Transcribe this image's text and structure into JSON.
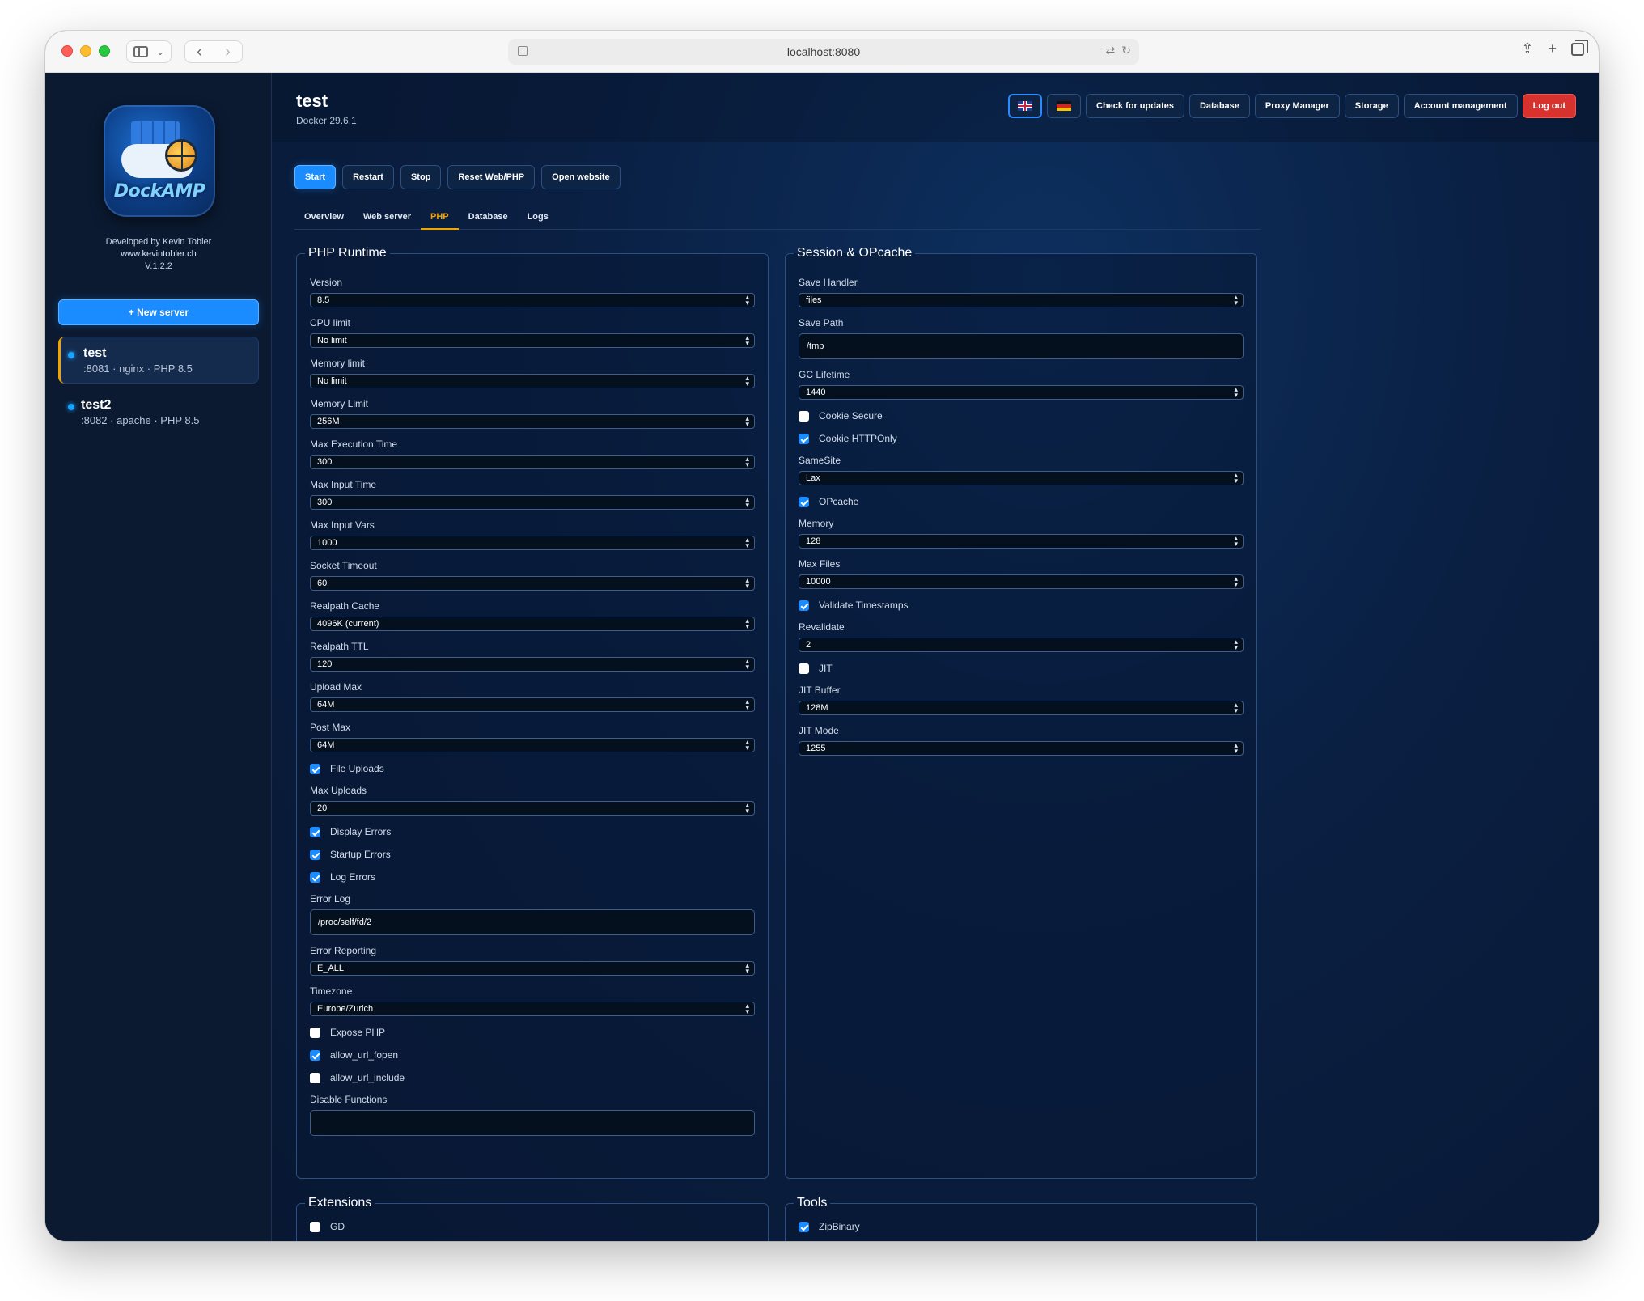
{
  "browser": {
    "url": "localhost:8080"
  },
  "sidebar": {
    "logo_text": "DockAMP",
    "credits": {
      "line1": "Developed by Kevin Tobler",
      "link": "www.kevintobler.ch",
      "version": "V.1.2.2"
    },
    "new_server_label": "+ New server",
    "servers": [
      {
        "name": "test",
        "meta": ":8081 · nginx · PHP 8.5",
        "active": true
      },
      {
        "name": "test2",
        "meta": ":8082 · apache · PHP 8.5",
        "active": false
      }
    ]
  },
  "header": {
    "title": "test",
    "subtitle": "Docker 29.6.1",
    "buttons": {
      "updates": "Check for updates",
      "database": "Database",
      "proxy": "Proxy Manager",
      "storage": "Storage",
      "account": "Account management",
      "logout": "Log out"
    },
    "languages": [
      "english-flag",
      "german-flag"
    ]
  },
  "actions": {
    "start": "Start",
    "restart": "Restart",
    "stop": "Stop",
    "reset": "Reset Web/PHP",
    "open": "Open website"
  },
  "tabs": {
    "overview": "Overview",
    "web": "Web server",
    "php": "PHP",
    "database": "Database",
    "logs": "Logs",
    "active": "PHP"
  },
  "php_runtime": {
    "title": "PHP Runtime",
    "version": {
      "label": "Version",
      "value": "8.5"
    },
    "cpu": {
      "label": "CPU limit",
      "value": "No limit"
    },
    "memory": {
      "label": "Memory limit",
      "value": "No limit"
    },
    "memory_limit": {
      "label": "Memory Limit",
      "value": "256M"
    },
    "max_exec": {
      "label": "Max Execution Time",
      "value": "300"
    },
    "max_input_time": {
      "label": "Max Input Time",
      "value": "300"
    },
    "max_input_vars": {
      "label": "Max Input Vars",
      "value": "1000"
    },
    "socket_timeout": {
      "label": "Socket Timeout",
      "value": "60"
    },
    "realpath_cache": {
      "label": "Realpath Cache",
      "value": "4096K (current)"
    },
    "realpath_ttl": {
      "label": "Realpath TTL",
      "value": "120"
    },
    "upload_max": {
      "label": "Upload Max",
      "value": "64M"
    },
    "post_max": {
      "label": "Post Max",
      "value": "64M"
    },
    "file_uploads": {
      "label": "File Uploads",
      "checked": true
    },
    "max_uploads": {
      "label": "Max Uploads",
      "value": "20"
    },
    "display_errors": {
      "label": "Display Errors",
      "checked": true
    },
    "startup_errors": {
      "label": "Startup Errors",
      "checked": true
    },
    "log_errors": {
      "label": "Log Errors",
      "checked": true
    },
    "error_log": {
      "label": "Error Log",
      "value": "/proc/self/fd/2"
    },
    "error_reporting": {
      "label": "Error Reporting",
      "value": "E_ALL"
    },
    "timezone": {
      "label": "Timezone",
      "value": "Europe/Zurich"
    },
    "expose_php": {
      "label": "Expose PHP",
      "checked": false
    },
    "allow_url_fopen": {
      "label": "allow_url_fopen",
      "checked": true
    },
    "allow_url_include": {
      "label": "allow_url_include",
      "checked": false
    },
    "disable_functions": {
      "label": "Disable Functions",
      "value": ""
    }
  },
  "session": {
    "title": "Session & OPcache",
    "save_handler": {
      "label": "Save Handler",
      "value": "files"
    },
    "save_path": {
      "label": "Save Path",
      "value": "/tmp"
    },
    "gc_lifetime": {
      "label": "GC Lifetime",
      "value": "1440"
    },
    "cookie_secure": {
      "label": "Cookie Secure",
      "checked": false
    },
    "cookie_httponly": {
      "label": "Cookie HTTPOnly",
      "checked": true
    },
    "samesite": {
      "label": "SameSite",
      "value": "Lax"
    },
    "opcache": {
      "label": "OPcache",
      "checked": true
    },
    "memory": {
      "label": "Memory",
      "value": "128"
    },
    "max_files": {
      "label": "Max Files",
      "value": "10000"
    },
    "validate_timestamps": {
      "label": "Validate Timestamps",
      "checked": true
    },
    "revalidate": {
      "label": "Revalidate",
      "value": "2"
    },
    "jit": {
      "label": "JIT",
      "checked": false
    },
    "jit_buffer": {
      "label": "JIT Buffer",
      "value": "128M"
    },
    "jit_mode": {
      "label": "JIT Mode",
      "value": "1255"
    }
  },
  "extensions": {
    "title": "Extensions",
    "gd": {
      "label": "GD",
      "checked": false
    }
  },
  "tools": {
    "title": "Tools",
    "zipbinary": {
      "label": "ZipBinary",
      "checked": true
    }
  },
  "colors": {
    "accent": "#1a8cff",
    "active_tab": "#f2a300",
    "logout": "#d8322e",
    "background": "#0a1a33"
  }
}
